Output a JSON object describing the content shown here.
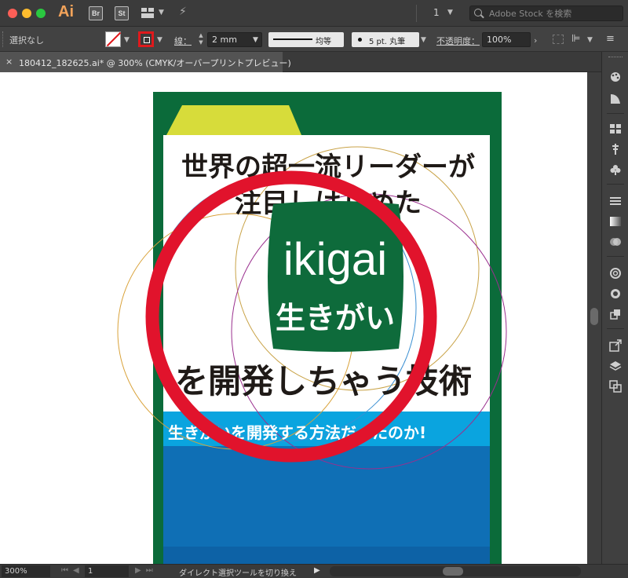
{
  "app": {
    "logo": "Ai",
    "bridge": "Br",
    "stock": "St",
    "page_indicator": "1",
    "stock_search_placeholder": "Adobe Stock を検索"
  },
  "control": {
    "selection": "選択なし",
    "stroke_label": "線：",
    "stroke_width": "2 mm",
    "stroke_profile": "均等",
    "brush": "5 pt. 丸筆",
    "opacity_label": "不透明度：",
    "opacity_value": "100%"
  },
  "document_tab": {
    "close": "×",
    "title": "180412_182625.ai* @ 300% (CMYK/オーバープリントプレビュー)"
  },
  "artwork": {
    "headline_1": "世界の超一流リーダーが",
    "headline_2": "注目しはじめた",
    "badge_latin": "ikigai",
    "badge_japanese": "生きがい",
    "headline_3": "を開発しちゃう技術",
    "subhead": "生きがいを開発する方法だったのか!",
    "colors": {
      "frame_green": "#0b6b3a",
      "tab_yellow": "#d7dc3a",
      "badge_green": "#0e6b3b",
      "subhead_cyan": "#0aa4df",
      "lower_blue": "#0f6fb5",
      "annotation_red": "#e1132c"
    }
  },
  "status": {
    "zoom": "300%",
    "page": "1",
    "tool_hint": "ダイレクト選択ツールを切り換え"
  },
  "dock_icons": [
    "brush-library-icon",
    "symbols-icon",
    "swatches-icon",
    "puppet-icon",
    "club-icon",
    "stroke-icon",
    "gradient-icon",
    "transparency-icon",
    "cc-libraries-icon",
    "appearance-icon",
    "graphic-styles-icon",
    "export-icon",
    "layers-icon",
    "artboards-icon"
  ]
}
